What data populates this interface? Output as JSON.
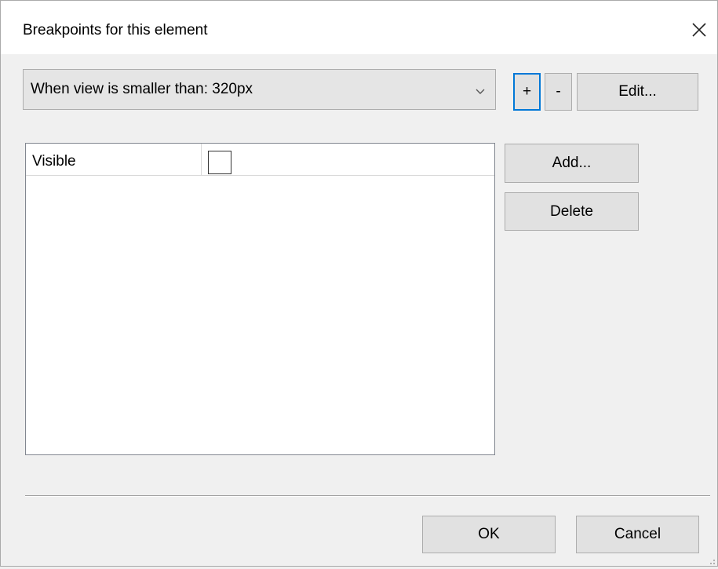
{
  "window": {
    "title": "Breakpoints for this element",
    "close_icon": "close-icon"
  },
  "breakpoint_select": {
    "value": "When view is smaller than: 320px",
    "arrow_icon": "chevron-down-icon"
  },
  "toolbar": {
    "plus_label": "+",
    "minus_label": "-",
    "edit_label": "Edit..."
  },
  "properties": {
    "rows": [
      {
        "name": "Visible",
        "checked": false
      }
    ]
  },
  "side_buttons": {
    "add_label": "Add...",
    "delete_label": "Delete"
  },
  "footer": {
    "ok_label": "OK",
    "cancel_label": "Cancel"
  },
  "colors": {
    "focus_border": "#0078d7",
    "dialog_bg": "#f0f0f0",
    "button_bg": "#e1e1e1"
  }
}
